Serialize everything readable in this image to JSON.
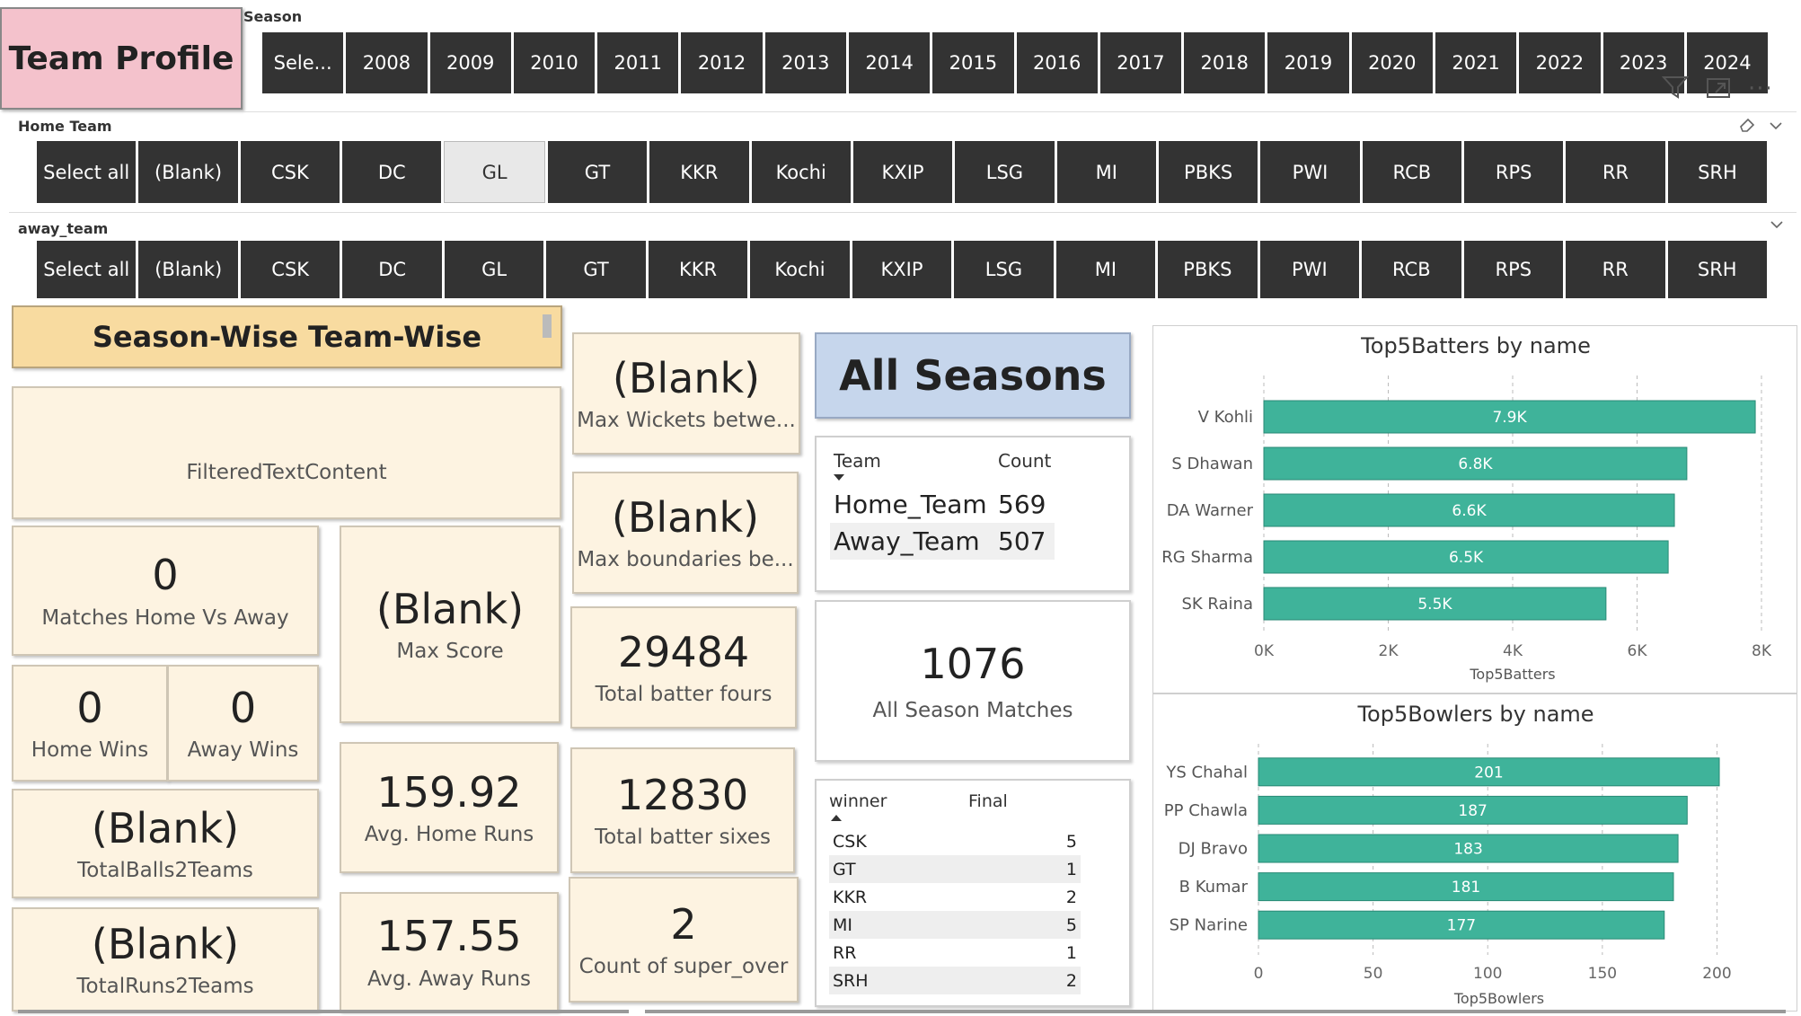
{
  "title": "Team Profile",
  "season_slicer": {
    "label": "Season",
    "items": [
      "Sele...",
      "2008",
      "2009",
      "2010",
      "2011",
      "2012",
      "2013",
      "2014",
      "2015",
      "2016",
      "2017",
      "2018",
      "2019",
      "2020",
      "2021",
      "2022",
      "2023",
      "2024"
    ]
  },
  "home_slicer": {
    "label": "Home Team",
    "items": [
      "Select all",
      "(Blank)",
      "CSK",
      "DC",
      "GL",
      "GT",
      "KKR",
      "Kochi",
      "KXIP",
      "LSG",
      "MI",
      "PBKS",
      "PWI",
      "RCB",
      "RPS",
      "RR",
      "SRH"
    ],
    "selected": "GL"
  },
  "away_slicer": {
    "label": "away_team",
    "items": [
      "Select all",
      "(Blank)",
      "CSK",
      "DC",
      "GL",
      "GT",
      "KKR",
      "Kochi",
      "KXIP",
      "LSG",
      "MI",
      "PBKS",
      "PWI",
      "RCB",
      "RPS",
      "RR",
      "SRH"
    ]
  },
  "section_header": "Season-Wise Team-Wise",
  "filtered_text": "FilteredTextContent",
  "cards": {
    "matches_home_vs_away": {
      "value": "0",
      "label": "Matches Home Vs Away"
    },
    "home_wins": {
      "value": "0",
      "label": "Home Wins"
    },
    "away_wins": {
      "value": "0",
      "label": "Away Wins"
    },
    "total_balls": {
      "value": "(Blank)",
      "label": "TotalBalls2Teams"
    },
    "total_runs": {
      "value": "(Blank)",
      "label": "TotalRuns2Teams"
    },
    "max_score": {
      "value": "(Blank)",
      "label": "Max Score"
    },
    "avg_home_runs": {
      "value": "159.92",
      "label": "Avg. Home Runs"
    },
    "avg_away_runs": {
      "value": "157.55",
      "label": "Avg. Away Runs"
    },
    "max_wickets": {
      "value": "(Blank)",
      "label": "Max Wickets betwe..."
    },
    "max_boundaries": {
      "value": "(Blank)",
      "label": "Max boundaries be..."
    },
    "total_fours": {
      "value": "29484",
      "label": "Total batter fours"
    },
    "total_sixes": {
      "value": "12830",
      "label": "Total batter sixes"
    },
    "super_over": {
      "value": "2",
      "label": "Count of super_over"
    }
  },
  "all_seasons": "All Seasons",
  "team_table": {
    "headers": [
      "Team",
      "Count"
    ],
    "rows": [
      [
        "Home_Team",
        "569"
      ],
      [
        "Away_Team",
        "507"
      ]
    ]
  },
  "all_season_matches": {
    "value": "1076",
    "label": "All Season Matches"
  },
  "winner_table": {
    "headers": [
      "winner",
      "Final"
    ],
    "rows": [
      [
        "CSK",
        "5"
      ],
      [
        "GT",
        "1"
      ],
      [
        "KKR",
        "2"
      ],
      [
        "MI",
        "5"
      ],
      [
        "RR",
        "1"
      ],
      [
        "SRH",
        "2"
      ]
    ]
  },
  "chart_data": [
    {
      "type": "bar",
      "title": "Top5Batters by name",
      "xlabel": "Top5Batters",
      "categories": [
        "V Kohli",
        "S Dhawan",
        "DA Warner",
        "RG Sharma",
        "SK Raina"
      ],
      "values": [
        7900,
        6800,
        6600,
        6500,
        5500
      ],
      "data_labels": [
        "7.9K",
        "6.8K",
        "6.6K",
        "6.5K",
        "5.5K"
      ],
      "xlim": [
        0,
        8000
      ],
      "ticks": [
        0,
        2000,
        4000,
        6000,
        8000
      ],
      "tick_labels": [
        "0K",
        "2K",
        "4K",
        "6K",
        "8K"
      ],
      "color": "#3fb39a"
    },
    {
      "type": "bar",
      "title": "Top5Bowlers by name",
      "xlabel": "Top5Bowlers",
      "categories": [
        "YS Chahal",
        "PP Chawla",
        "DJ Bravo",
        "B Kumar",
        "SP Narine"
      ],
      "values": [
        201,
        187,
        183,
        181,
        177
      ],
      "data_labels": [
        "201",
        "187",
        "183",
        "181",
        "177"
      ],
      "xlim": [
        0,
        210
      ],
      "ticks": [
        0,
        50,
        100,
        150,
        200
      ],
      "tick_labels": [
        "0",
        "50",
        "100",
        "150",
        "200"
      ],
      "color": "#3fb39a"
    }
  ],
  "colors": {
    "title_bg": "#f4c2cc",
    "header_bg": "#f8dba0",
    "card_bg": "#fdf3e1",
    "all_seasons_bg": "#c6d6ec",
    "slicer_tile": "#333333",
    "bar": "#3fb39a"
  },
  "icons": [
    "filter-icon",
    "focus-mode-icon",
    "more-options-icon",
    "eraser-icon",
    "chevron-down-icon"
  ]
}
